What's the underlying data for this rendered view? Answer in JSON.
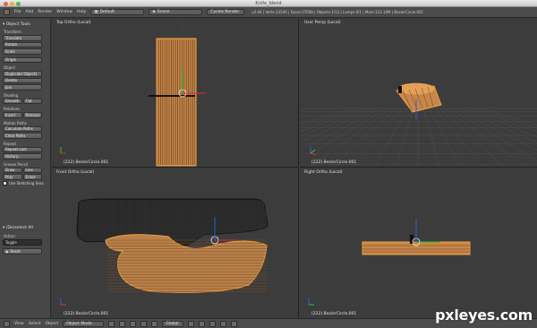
{
  "window": {
    "title": "Knife_blend"
  },
  "info_header": {
    "menus": [
      "File",
      "Add",
      "Render",
      "Window",
      "Help"
    ],
    "layout": "Default",
    "scene": "Scene",
    "engine": "Cycles Render",
    "stats": "v2.64 | Verts:13540 | Faces:27008 | Objects:1/12 | Lamps:0/1 | Mem:123.10M | BezierCircle.001"
  },
  "tool_shelf": {
    "title": "Object Tools",
    "sections": {
      "transform": {
        "label": "Transform",
        "buttons": [
          "Translate",
          "Rotate",
          "Scale",
          "Origin"
        ]
      },
      "object": {
        "label": "Object",
        "buttons": [
          "Duplicate Objects",
          "Delete",
          "Join"
        ]
      },
      "shading": {
        "label": "Shading",
        "buttons": [
          "Smooth",
          "Flat"
        ]
      },
      "relations": {
        "label": "Relations",
        "buttons": [
          "Insert",
          "Remove"
        ]
      },
      "motion": {
        "label": "Motion Paths",
        "buttons": [
          "Calculate Paths",
          "Clear Paths"
        ]
      },
      "repeat": {
        "label": "Repeat",
        "buttons": [
          "Repeat Last",
          "History..."
        ]
      },
      "grease": {
        "label": "Grease Pencil",
        "buttons": [
          "Draw",
          "Line",
          "Poly",
          "Erase"
        ]
      }
    },
    "use_sketching": "Use Sketching Sess",
    "operator": {
      "title": "(De)select All",
      "action_label": "Action:",
      "action_value": "Toggle",
      "reset_label": "Reset"
    }
  },
  "viewports": {
    "top_left": {
      "label": "Top Ortho (Local)",
      "object": "(222) BezierCircle.001"
    },
    "top_right": {
      "label": "User Persp (Local)",
      "object": "(222) BezierCircle.001"
    },
    "bottom_left": {
      "label": "Front Ortho (Local)",
      "object": "(222) BezierCircle.001"
    },
    "bottom_right": {
      "label": "Right Ortho (Local)",
      "object": "(222) BezierCircle.001"
    }
  },
  "bottom_header": {
    "view": "View",
    "select": "Select",
    "object": "Object",
    "mode": "Object Mode",
    "pivot": "Global"
  },
  "watermark": "pxleyes.com",
  "colors": {
    "selection": "#f0a040",
    "axis_x": "#d23030",
    "axis_y": "#30c030",
    "axis_z": "#3060d0"
  }
}
